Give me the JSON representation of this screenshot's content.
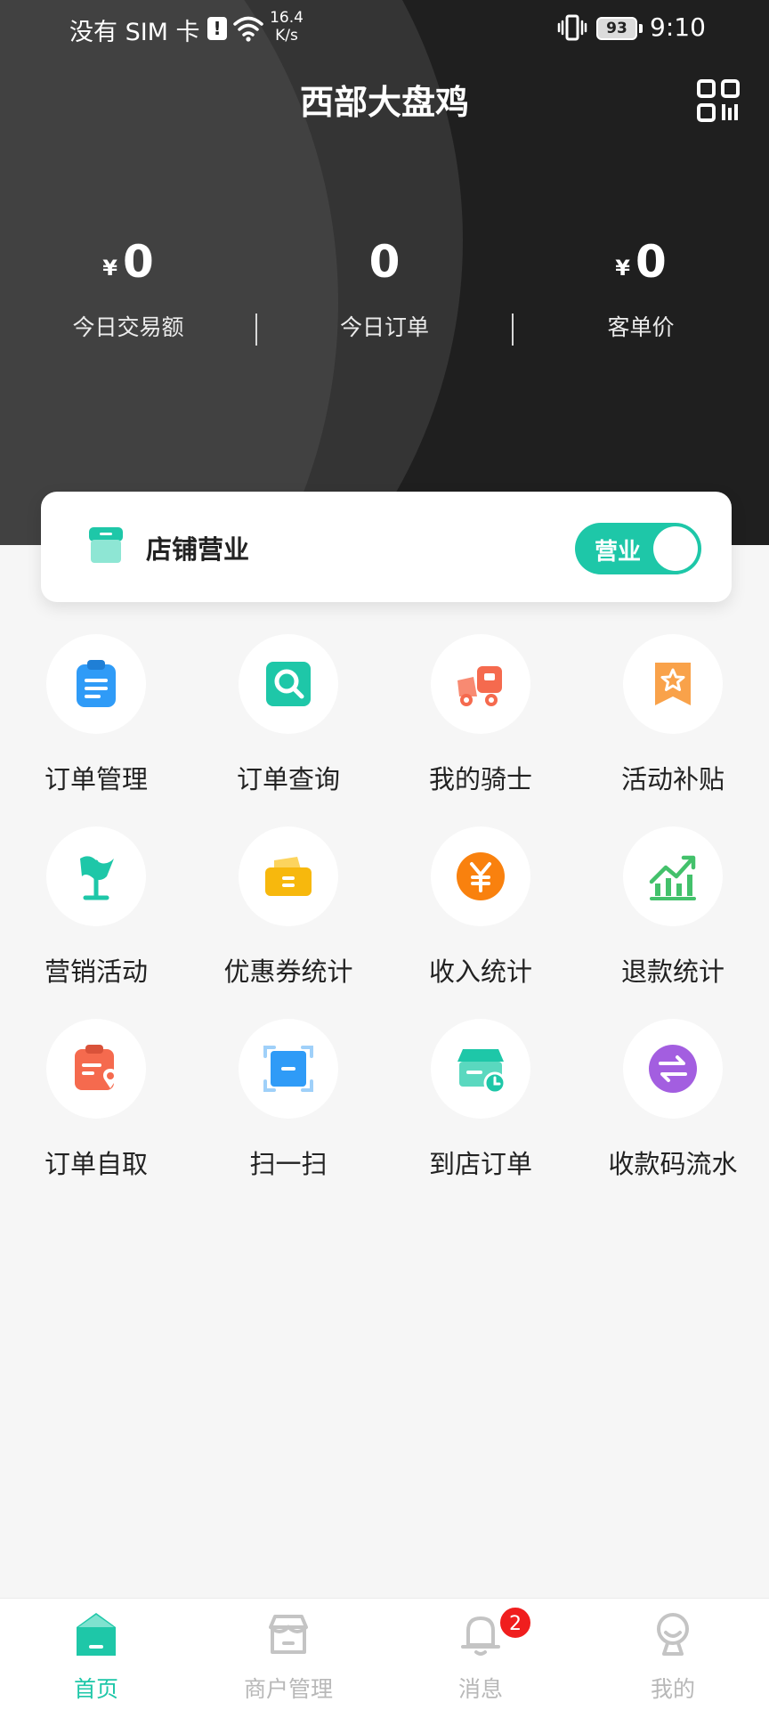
{
  "status_bar": {
    "sim": "没有 SIM 卡",
    "net_speed_value": "16.4",
    "net_speed_unit": "K/s",
    "battery": "93",
    "time": "9:10"
  },
  "header": {
    "title": "西部大盘鸡",
    "qr_icon": "qr-code-icon"
  },
  "stats": [
    {
      "currency": "¥",
      "value": "0",
      "label": "今日交易额"
    },
    {
      "currency": "",
      "value": "0",
      "label": "今日订单"
    },
    {
      "currency": "¥",
      "value": "0",
      "label": "客单价"
    }
  ],
  "store_card": {
    "label": "店铺营业",
    "toggle_label": "营业",
    "toggle_on": true
  },
  "grid": [
    {
      "label": "订单管理",
      "icon": "clipboard-icon",
      "color": "#2f9bf7"
    },
    {
      "label": "订单查询",
      "icon": "search-doc-icon",
      "color": "#1ec7a8"
    },
    {
      "label": "我的骑士",
      "icon": "delivery-truck-icon",
      "color": "#f56a4e"
    },
    {
      "label": "活动补贴",
      "icon": "star-badge-icon",
      "color": "#f9a24a"
    },
    {
      "label": "营销活动",
      "icon": "flag-icon",
      "color": "#1ec7a8"
    },
    {
      "label": "优惠券统计",
      "icon": "coupon-wallet-icon",
      "color": "#f7b80d"
    },
    {
      "label": "收入统计",
      "icon": "yen-coin-icon",
      "color": "#f9810e"
    },
    {
      "label": "退款统计",
      "icon": "bar-trend-icon",
      "color": "#43c16b"
    },
    {
      "label": "订单自取",
      "icon": "pickup-location-icon",
      "color": "#f56a4e"
    },
    {
      "label": "扫一扫",
      "icon": "scan-icon",
      "color": "#2f9bf7"
    },
    {
      "label": "到店订单",
      "icon": "store-clock-icon",
      "color": "#1ec7a8"
    },
    {
      "label": "收款码流水",
      "icon": "transfer-icon",
      "color": "#a35ee0"
    }
  ],
  "bottom_nav": [
    {
      "label": "首页",
      "icon": "home-icon",
      "active": true
    },
    {
      "label": "商户管理",
      "icon": "shop-icon",
      "active": false
    },
    {
      "label": "消息",
      "icon": "bell-icon",
      "active": false,
      "badge": "2"
    },
    {
      "label": "我的",
      "icon": "profile-icon",
      "active": false
    }
  ],
  "colors": {
    "accent": "#1ec7a8",
    "header_bg": "#1f1f1f",
    "badge": "#f01e1e"
  }
}
